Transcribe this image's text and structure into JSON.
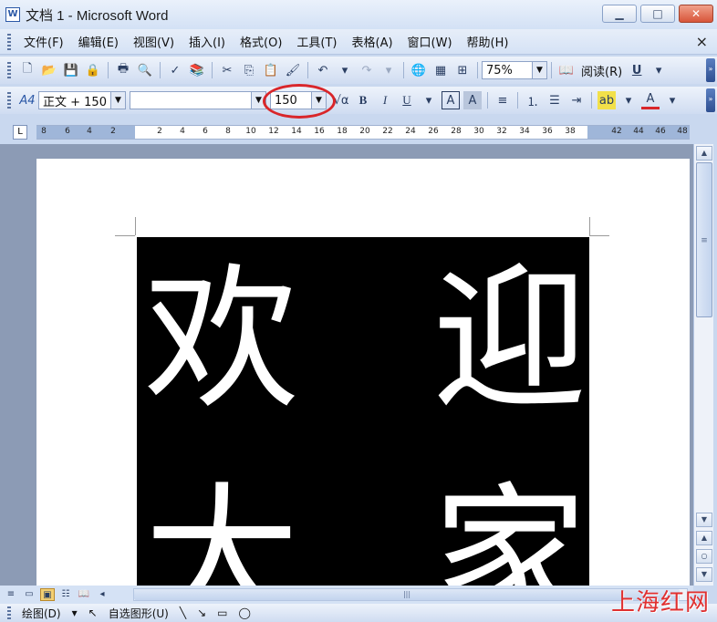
{
  "window": {
    "title": "文档 1 - Microsoft Word",
    "app_icon": "W"
  },
  "menu": {
    "items": [
      "文件(F)",
      "编辑(E)",
      "视图(V)",
      "插入(I)",
      "格式(O)",
      "工具(T)",
      "表格(A)",
      "窗口(W)",
      "帮助(H)"
    ],
    "close": "×"
  },
  "toolbar1": {
    "zoom": "75%",
    "read_label": "阅读(R)"
  },
  "toolbar2": {
    "style": "正文 + 150",
    "font_name": "",
    "font_size": "150"
  },
  "ruler": {
    "ticks_left": [
      "8",
      "6",
      "4",
      "2"
    ],
    "ticks_right": [
      "2",
      "4",
      "6",
      "8",
      "10",
      "12",
      "14",
      "16",
      "18",
      "20",
      "22",
      "24",
      "26",
      "28",
      "30",
      "32",
      "34",
      "36",
      "38",
      "42",
      "44",
      "46",
      "48"
    ]
  },
  "document": {
    "chars": [
      "欢",
      "迎",
      "大",
      "家"
    ]
  },
  "drawing_toolbar": {
    "draw_label": "绘图(D)",
    "autoshapes_label": "自选图形(U)"
  },
  "watermark": "上海红网",
  "colors": {
    "highlight": "#d9262a",
    "title_bar": "#d3e1f5",
    "doc_bg": "#000000"
  }
}
